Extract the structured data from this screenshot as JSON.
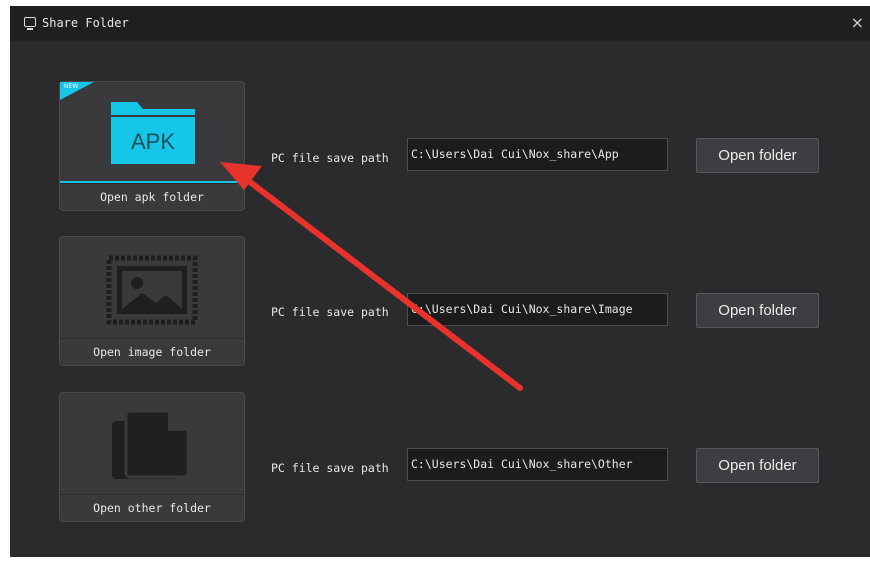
{
  "window": {
    "title": "Share Folder",
    "close_glyph": "×"
  },
  "rows": [
    {
      "id": "apk",
      "tile_caption": "Open apk folder",
      "icon": "apk-folder-icon",
      "icon_text": "APK",
      "badge_text": "NEW",
      "selected": true,
      "path_label": "PC file save path",
      "path_value": "C:\\Users\\Dai Cui\\Nox_share\\App",
      "button_label": "Open folder"
    },
    {
      "id": "image",
      "tile_caption": "Open image folder",
      "icon": "image-icon",
      "path_label": "PC file save path",
      "path_value": "C:\\Users\\Dai Cui\\Nox_share\\Image",
      "button_label": "Open folder"
    },
    {
      "id": "other",
      "tile_caption": "Open other folder",
      "icon": "documents-icon",
      "path_label": "PC file save path",
      "path_value": "C:\\Users\\Dai Cui\\Nox_share\\Other",
      "button_label": "Open folder"
    }
  ],
  "colors": {
    "accent": "#15c6e8",
    "window_bg": "#2b2b2d",
    "titlebar_bg": "#1f1f21",
    "tile_bg": "#3a3a3d",
    "annotation_arrow": "#e8322c"
  }
}
